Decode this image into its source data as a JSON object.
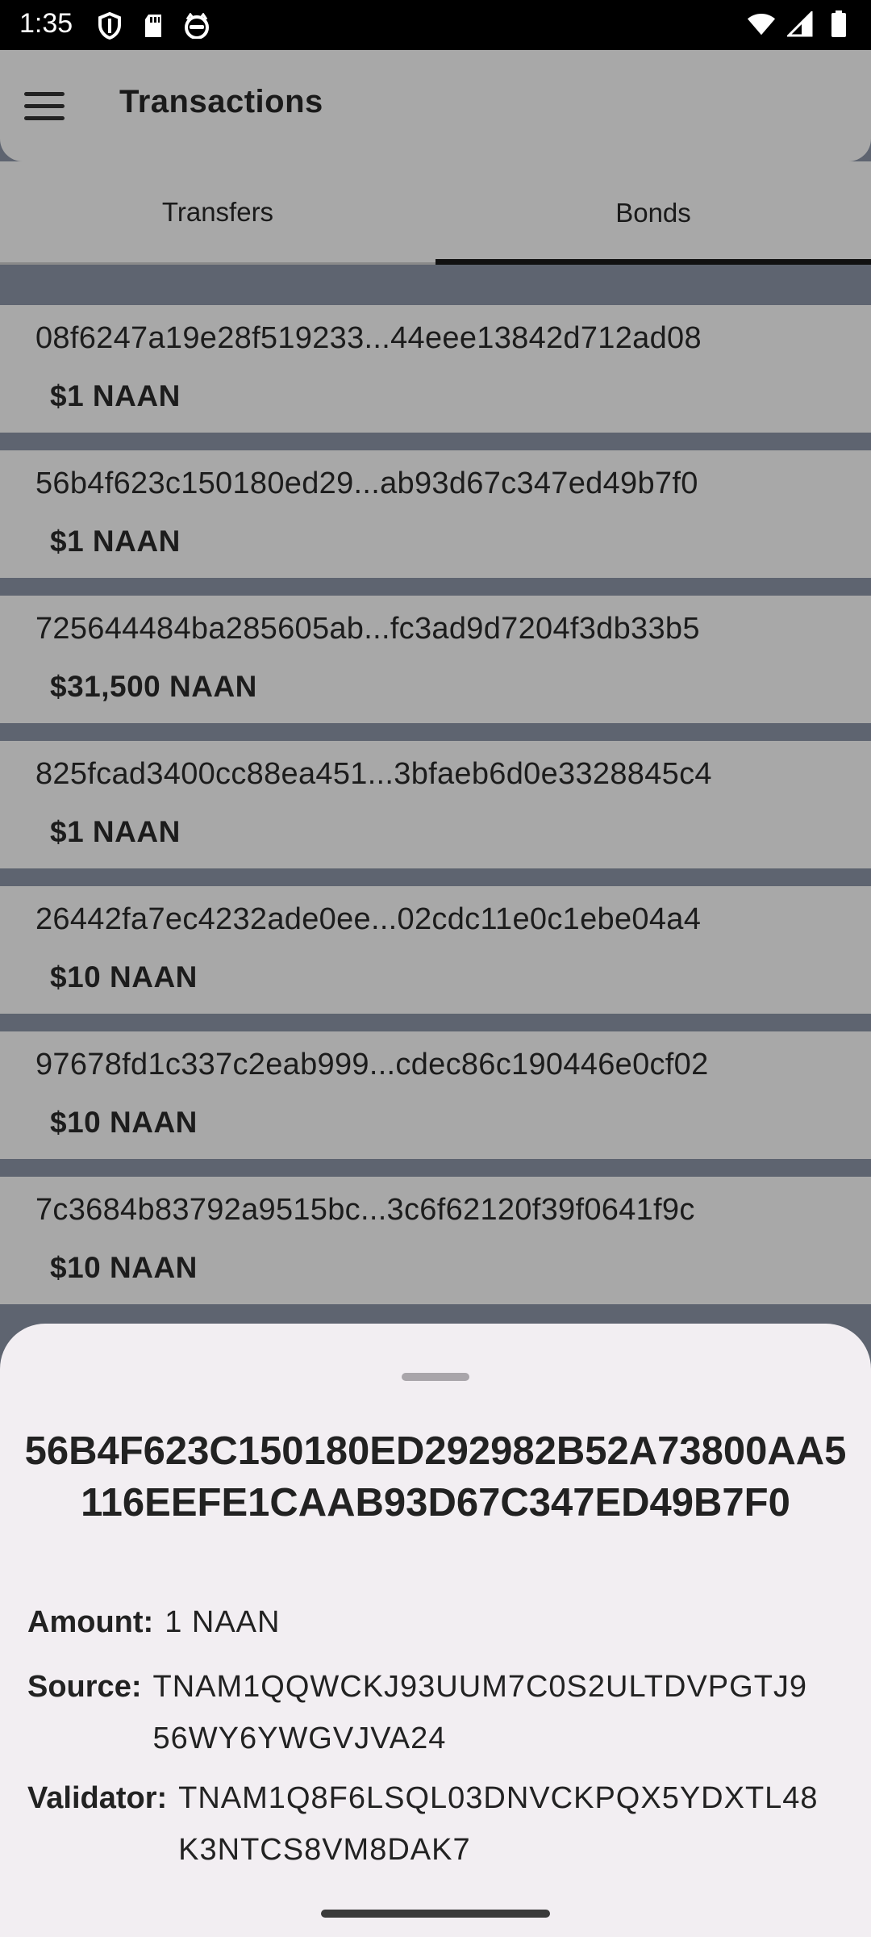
{
  "status_bar": {
    "time": "1:35",
    "left_icons": [
      "shield-icon",
      "sd-card-icon",
      "cat-face-icon"
    ],
    "right_icons": [
      "wifi-icon",
      "signal-icon",
      "battery-icon"
    ]
  },
  "app_bar": {
    "title": "Transactions",
    "menu_icon": "hamburger-menu-icon"
  },
  "tabs": [
    {
      "label": "Transfers",
      "selected": false
    },
    {
      "label": "Bonds",
      "selected": true
    }
  ],
  "bonds": [
    {
      "hash": "08f6247a19e28f519233...44eee13842d712ad08",
      "amount": "$1 NAAN"
    },
    {
      "hash": "56b4f623c150180ed29...ab93d67c347ed49b7f0",
      "amount": "$1 NAAN"
    },
    {
      "hash": "725644484ba285605ab...fc3ad9d7204f3db33b5",
      "amount": "$31,500 NAAN"
    },
    {
      "hash": "825fcad3400cc88ea451...3bfaeb6d0e3328845c4",
      "amount": "$1 NAAN"
    },
    {
      "hash": "26442fa7ec4232ade0ee...02cdc11e0c1ebe04a4",
      "amount": "$10 NAAN"
    },
    {
      "hash": "97678fd1c337c2eab999...cdec86c190446e0cf02",
      "amount": "$10 NAAN"
    },
    {
      "hash": "7c3684b83792a9515bc...3c6f62120f39f0641f9c",
      "amount": "$10 NAAN"
    }
  ],
  "sheet": {
    "title": "56B4F623C150180ED292982B52A73800AA5116EEFE1CAAB93D67C347ED49B7F0",
    "amount_label": "Amount:",
    "amount_value": "1 NAAN",
    "source_label": "Source:",
    "source_value": "TNAM1QQWCKJ93UUM7C0S2ULTDVPGTJ956WY6YWGVJVA24",
    "validator_label": "Validator:",
    "validator_value": "TNAM1Q8F6LSQL03DNVCKPQX5YDXTL48K3NTCS8VM8DAK7"
  },
  "colors": {
    "scrim_surface": "#a8a8a8",
    "scrim_background": "#5e6470",
    "sheet_background": "#f2eef2",
    "tab_indicator": "#111111"
  }
}
